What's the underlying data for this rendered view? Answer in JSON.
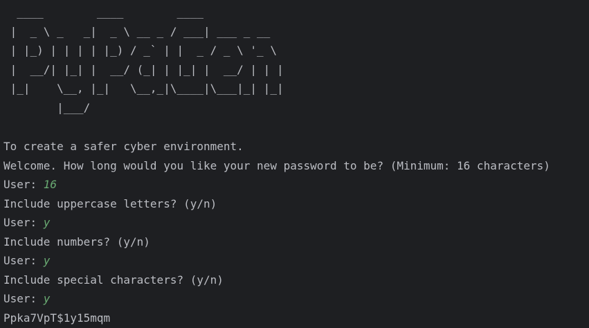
{
  "terminal": {
    "banner": "  ____        ____        ____\n |  _ \\ _   _|  _ \\ __ _ / ___| ___ _ __\n | |_) | | | | |_) / _` | |  _ / _ \\ '_ \\\n |  __/| |_| |  __/ (_| | |_| |  __/ | | |\n |_|    \\__, |_|   \\__,_|\\____|\\___|_| |_|\n        |___/",
    "tagline": "To create a safer cyber environment.",
    "welcome_prompt": "Welcome. How long would you like your new password to be? (Minimum: 16 characters)",
    "user_label": "User: ",
    "length_answer": "16",
    "uppercase_prompt": "Include uppercase letters? (y/n)",
    "uppercase_answer": "y",
    "numbers_prompt": "Include numbers? (y/n)",
    "numbers_answer": "y",
    "special_prompt": "Include special characters? (y/n)",
    "special_answer": "y",
    "generated_password": "Ppka7VpT$1y15mqm"
  },
  "colors": {
    "background": "#1e1f22",
    "text": "#bcbec4",
    "user_input": "#6aab73"
  }
}
